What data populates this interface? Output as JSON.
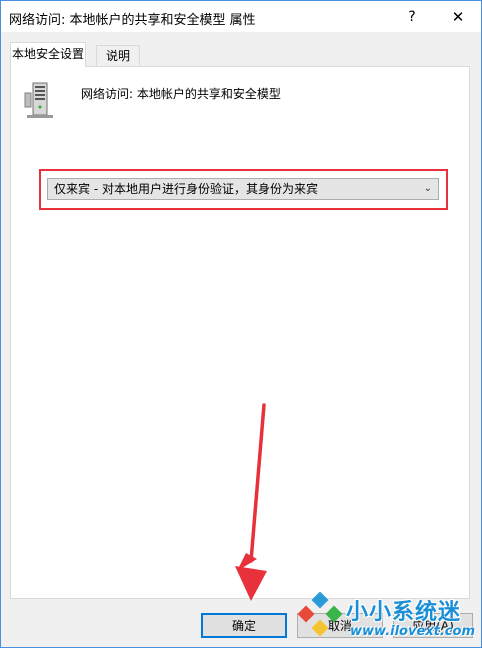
{
  "window": {
    "title": "网络访问: 本地帐户的共享和安全模型 属性",
    "help_glyph": "?",
    "close_glyph": "✕"
  },
  "tabs": [
    {
      "label": "本地安全设置",
      "active": true
    },
    {
      "label": "说明",
      "active": false
    }
  ],
  "policy": {
    "icon": "server-icon",
    "name": "网络访问: 本地帐户的共享和安全模型"
  },
  "dropdown": {
    "selected": "仅来宾 - 对本地用户进行身份验证，其身份为来宾",
    "arrow_glyph": "⌄"
  },
  "buttons": {
    "ok": "确定",
    "cancel": "取消",
    "apply": "应用(A)"
  },
  "watermark": {
    "title": "小小系统迷",
    "url": "www.ilovext.com"
  },
  "colors": {
    "highlight": "#e8313a",
    "accent": "#0078d7",
    "watermark": "#1a8fd8"
  }
}
